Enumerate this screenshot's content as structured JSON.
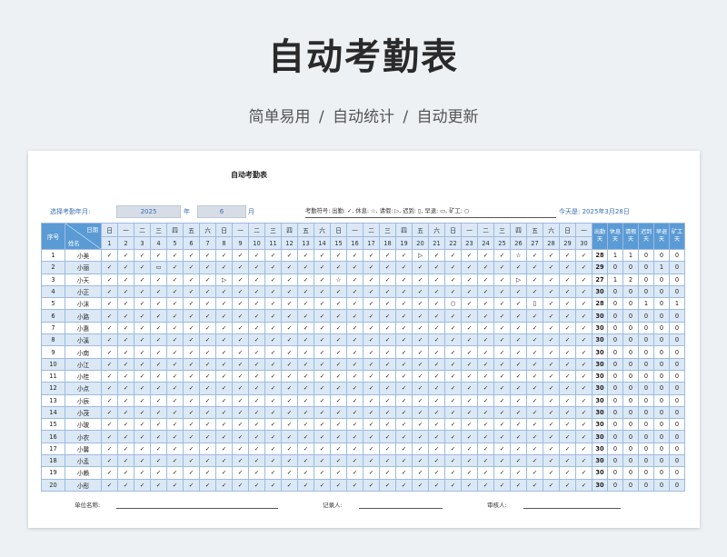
{
  "page_title": "自动考勤表",
  "subtitle": "简单易用  /  自动统计  /  自动更新",
  "sheet": {
    "title": "自动考勤表",
    "select_label": "选择考勤年月:",
    "year": "2025",
    "year_unit": "年",
    "month": "6",
    "month_unit": "月",
    "legend": "考勤符号:          出勤: ✓, 休息: ☆, 请假: ▷, 迟到: ▯, 早退: ▭, 矿工: ○",
    "today": "今天是:    2025年3月28日"
  },
  "headers": {
    "seq": "序号",
    "date": "日期",
    "name": "姓名",
    "weekdays": [
      "日",
      "一",
      "二",
      "三",
      "四",
      "五",
      "六",
      "日",
      "一",
      "二",
      "三",
      "四",
      "五",
      "六",
      "日",
      "一",
      "二",
      "三",
      "四",
      "五",
      "六",
      "日",
      "一",
      "二",
      "三",
      "四",
      "五",
      "六",
      "日",
      "一"
    ],
    "days": [
      "1",
      "2",
      "3",
      "4",
      "5",
      "6",
      "7",
      "8",
      "9",
      "10",
      "11",
      "12",
      "13",
      "14",
      "15",
      "16",
      "17",
      "18",
      "19",
      "20",
      "21",
      "22",
      "23",
      "24",
      "25",
      "26",
      "27",
      "28",
      "29",
      "30"
    ],
    "stats": [
      "出勤天",
      "休息天",
      "请假天",
      "迟到天",
      "早退天",
      "矿工天"
    ]
  },
  "rows": [
    {
      "seq": "1",
      "name": "小美",
      "marks": "✓✓✓✓✓✓✓✓✓✓✓✓✓✓✓✓✓✓✓▷✓✓✓✓✓☆✓✓✓✓",
      "stats": [
        "28",
        "1",
        "1",
        "0",
        "0",
        "0"
      ]
    },
    {
      "seq": "2",
      "name": "小丽",
      "marks": "✓✓✓▭✓✓✓✓✓✓✓✓✓✓✓✓✓✓✓✓✓✓✓✓✓✓✓✓✓✓",
      "stats": [
        "29",
        "0",
        "0",
        "0",
        "1",
        "0"
      ]
    },
    {
      "seq": "3",
      "name": "小天",
      "marks": "✓✓✓✓✓✓✓▷✓✓✓✓✓✓☆✓✓✓✓✓✓✓✓✓✓▷✓✓✓✓",
      "stats": [
        "27",
        "1",
        "2",
        "0",
        "0",
        "0"
      ]
    },
    {
      "seq": "4",
      "name": "小正",
      "marks": "✓✓✓✓✓✓✓✓✓✓✓✓✓✓✓✓✓✓✓✓✓✓✓✓✓✓✓✓✓✓",
      "stats": [
        "30",
        "0",
        "0",
        "0",
        "0",
        "0"
      ]
    },
    {
      "seq": "5",
      "name": "小沫",
      "marks": "✓✓✓✓✓✓✓✓✓✓✓✓✓✓✓✓✓✓✓✓✓○✓✓✓✓▯✓✓✓",
      "stats": [
        "28",
        "0",
        "0",
        "1",
        "0",
        "1"
      ]
    },
    {
      "seq": "6",
      "name": "小路",
      "marks": "✓✓✓✓✓✓✓✓✓✓✓✓✓✓✓✓✓✓✓✓✓✓✓✓✓✓✓✓✓✓",
      "stats": [
        "30",
        "0",
        "0",
        "0",
        "0",
        "0"
      ]
    },
    {
      "seq": "7",
      "name": "小惠",
      "marks": "✓✓✓✓✓✓✓✓✓✓✓✓✓✓✓✓✓✓✓✓✓✓✓✓✓✓✓✓✓✓",
      "stats": [
        "30",
        "0",
        "0",
        "0",
        "0",
        "0"
      ]
    },
    {
      "seq": "8",
      "name": "小溪",
      "marks": "✓✓✓✓✓✓✓✓✓✓✓✓✓✓✓✓✓✓✓✓✓✓✓✓✓✓✓✓✓✓",
      "stats": [
        "30",
        "0",
        "0",
        "0",
        "0",
        "0"
      ]
    },
    {
      "seq": "9",
      "name": "小南",
      "marks": "✓✓✓✓✓✓✓✓✓✓✓✓✓✓✓✓✓✓✓✓✓✓✓✓✓✓✓✓✓✓",
      "stats": [
        "30",
        "0",
        "0",
        "0",
        "0",
        "0"
      ]
    },
    {
      "seq": "10",
      "name": "小江",
      "marks": "✓✓✓✓✓✓✓✓✓✓✓✓✓✓✓✓✓✓✓✓✓✓✓✓✓✓✓✓✓✓",
      "stats": [
        "30",
        "0",
        "0",
        "0",
        "0",
        "0"
      ]
    },
    {
      "seq": "11",
      "name": "小桂",
      "marks": "✓✓✓✓✓✓✓✓✓✓✓✓✓✓✓✓✓✓✓✓✓✓✓✓✓✓✓✓✓✓",
      "stats": [
        "30",
        "0",
        "0",
        "0",
        "0",
        "0"
      ]
    },
    {
      "seq": "12",
      "name": "小点",
      "marks": "✓✓✓✓✓✓✓✓✓✓✓✓✓✓✓✓✓✓✓✓✓✓✓✓✓✓✓✓✓✓",
      "stats": [
        "30",
        "0",
        "0",
        "0",
        "0",
        "0"
      ]
    },
    {
      "seq": "13",
      "name": "小辰",
      "marks": "✓✓✓✓✓✓✓✓✓✓✓✓✓✓✓✓✓✓✓✓✓✓✓✓✓✓✓✓✓✓",
      "stats": [
        "30",
        "0",
        "0",
        "0",
        "0",
        "0"
      ]
    },
    {
      "seq": "14",
      "name": "小茂",
      "marks": "✓✓✓✓✓✓✓✓✓✓✓✓✓✓✓✓✓✓✓✓✓✓✓✓✓✓✓✓✓✓",
      "stats": [
        "30",
        "0",
        "0",
        "0",
        "0",
        "0"
      ]
    },
    {
      "seq": "15",
      "name": "小玻",
      "marks": "✓✓✓✓✓✓✓✓✓✓✓✓✓✓✓✓✓✓✓✓✓✓✓✓✓✓✓✓✓✓",
      "stats": [
        "30",
        "0",
        "0",
        "0",
        "0",
        "0"
      ]
    },
    {
      "seq": "16",
      "name": "小农",
      "marks": "✓✓✓✓✓✓✓✓✓✓✓✓✓✓✓✓✓✓✓✓✓✓✓✓✓✓✓✓✓✓",
      "stats": [
        "30",
        "0",
        "0",
        "0",
        "0",
        "0"
      ]
    },
    {
      "seq": "17",
      "name": "小馨",
      "marks": "✓✓✓✓✓✓✓✓✓✓✓✓✓✓✓✓✓✓✓✓✓✓✓✓✓✓✓✓✓✓",
      "stats": [
        "30",
        "0",
        "0",
        "0",
        "0",
        "0"
      ]
    },
    {
      "seq": "18",
      "name": "小孟",
      "marks": "✓✓✓✓✓✓✓✓✓✓✓✓✓✓✓✓✓✓✓✓✓✓✓✓✓✓✓✓✓✓",
      "stats": [
        "30",
        "0",
        "0",
        "0",
        "0",
        "0"
      ]
    },
    {
      "seq": "19",
      "name": "小赖",
      "marks": "✓✓✓✓✓✓✓✓✓✓✓✓✓✓✓✓✓✓✓✓✓✓✓✓✓✓✓✓✓✓",
      "stats": [
        "30",
        "0",
        "0",
        "0",
        "0",
        "0"
      ]
    },
    {
      "seq": "20",
      "name": "小彤",
      "marks": "✓✓✓✓✓✓✓✓✓✓✓✓✓✓✓✓✓✓✓✓✓✓✓✓✓✓✓✓✓✓",
      "stats": [
        "30",
        "0",
        "0",
        "0",
        "0",
        "0"
      ]
    }
  ],
  "footer": {
    "unit_label": "单位名称:",
    "recorder_label": "记录人:",
    "reviewer_label": "审核人:"
  },
  "colors": {
    "header_blue": "#5b9bd5",
    "band_blue": "#dbe8f5",
    "grid_line": "#9dbbe0"
  }
}
